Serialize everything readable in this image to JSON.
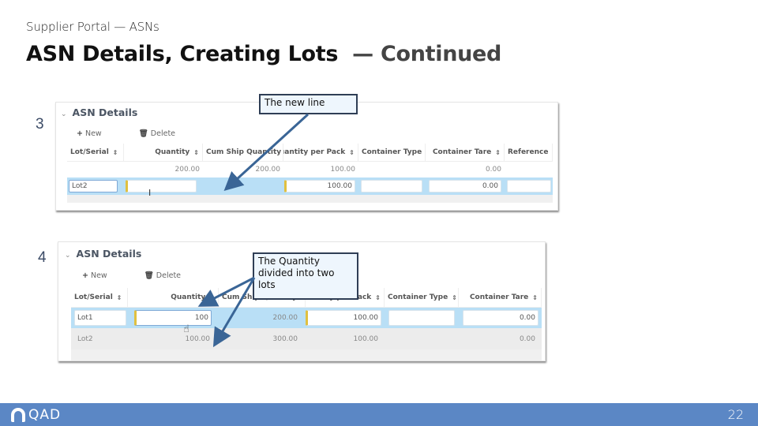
{
  "slide": {
    "subtitle": "Supplier Portal — ASNs",
    "title": "ASN Details, Creating Lots",
    "title_suffix": "— Continued",
    "page_number": "22",
    "logo_text": "QAD"
  },
  "steps": [
    {
      "number": "3",
      "callout": "The new line",
      "panel": {
        "title": "ASN Details",
        "toolbar": {
          "new_label": "New",
          "delete_label": "Delete"
        },
        "columns": [
          "Lot/Serial",
          "Quantity",
          "Cum Ship Quantity",
          "Quantity per Pack",
          "Container Type",
          "Container Tare",
          "Reference"
        ],
        "rows": [
          {
            "lot": "",
            "quantity": "200.00",
            "cum_ship": "200.00",
            "qty_per_pack": "100.00",
            "container_type": "",
            "container_tare": "0.00",
            "reference": ""
          },
          {
            "lot": "Lot2",
            "quantity": "",
            "cum_ship": "",
            "qty_per_pack": "100.00",
            "container_type": "",
            "container_tare": "0.00",
            "reference": "",
            "editing": true
          }
        ]
      }
    },
    {
      "number": "4",
      "callout": "The Quantity divided into two lots",
      "panel": {
        "title": "ASN Details",
        "toolbar": {
          "new_label": "New",
          "delete_label": "Delete"
        },
        "columns": [
          "Lot/Serial",
          "Quantity",
          "Cum Ship Quantity",
          "Quantity per Pack",
          "Container Type",
          "Container Tare"
        ],
        "rows": [
          {
            "lot": "Lot1",
            "quantity": "100",
            "cum_ship": "200.00",
            "qty_per_pack": "100.00",
            "container_type": "",
            "container_tare": "0.00",
            "editing": true
          },
          {
            "lot": "Lot2",
            "quantity": "100.00",
            "cum_ship": "300.00",
            "qty_per_pack": "100.00",
            "container_type": "",
            "container_tare": "0.00"
          }
        ]
      }
    }
  ]
}
